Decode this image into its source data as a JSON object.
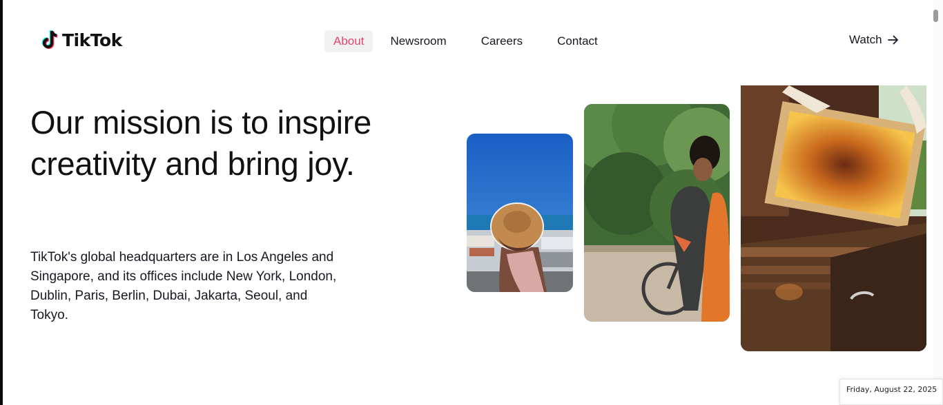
{
  "brand": {
    "name": "TikTok"
  },
  "nav": {
    "items": [
      {
        "label": "About",
        "active": true
      },
      {
        "label": "Newsroom",
        "active": false
      },
      {
        "label": "Careers",
        "active": false
      },
      {
        "label": "Contact",
        "active": false
      }
    ],
    "watch_label": "Watch"
  },
  "hero": {
    "headline": "Our mission is to inspire creativity and bring joy.",
    "description": "TikTok's global headquarters are in Los Angeles and Singapore, and its offices include New York, London, Dublin, Paris, Berlin, Dubai, Jakarta, Seoul, and Tokyo."
  },
  "photos": [
    {
      "icon": "photo-woman-straw-hat-coast"
    },
    {
      "icon": "photo-woman-riding-bicycle"
    },
    {
      "icon": "photo-beekeeper-honeycomb-frame"
    }
  ],
  "colors": {
    "accent": "#e0466d",
    "nav_active_bg": "#f1f1f2",
    "text": "#161823"
  },
  "system": {
    "date_tooltip": "Friday, August 22, 2025"
  }
}
